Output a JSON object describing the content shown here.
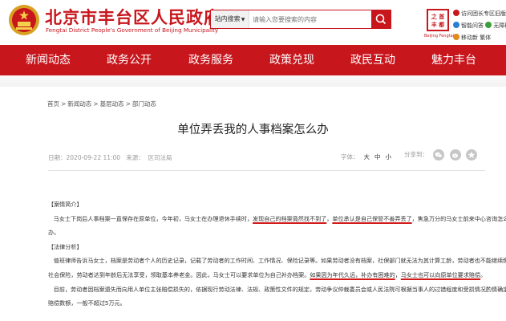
{
  "header": {
    "site_title": "北京市丰台区人民政府",
    "site_subtitle": "Fengtai District People's Government of Beijing Municipality",
    "search": {
      "scope_label": "站内搜索",
      "placeholder": "请输入您要搜索的内容"
    },
    "logo_caption": "Beijing Fengtai",
    "util_links": [
      "访问团长专区旧版",
      "智能问答",
      "无障碍",
      "移动新",
      "繁体"
    ]
  },
  "nav": {
    "items": [
      "新闻动态",
      "政务公开",
      "政务服务",
      "政策兑现",
      "政民互动",
      "魅力丰台"
    ]
  },
  "breadcrumb": {
    "items": [
      "首页",
      "新闻动态",
      "基层动态",
      "部门动态"
    ],
    "separator": ">"
  },
  "article": {
    "title": "单位弄丢我的人事档案怎么办",
    "date_label": "日期：2020-09-22 11:00",
    "source_label": "来源：",
    "source_value": "区司法局",
    "font_size": {
      "label": "字体：",
      "options": [
        "大",
        "中",
        "小"
      ]
    },
    "share_label": "分享到："
  },
  "content": {
    "case_heading": "【案情简介】",
    "p1_a": "马女士下岗后人事档案一直保存在原单位，今年初，马女士在办理退休手续时，",
    "p1_hl1": "发现自己的档案竟然找不到了",
    "p1_b": "，",
    "p1_hl2": "单位承认是自己保管不善弄丢了",
    "p1_c": "，焦急万分的马女士前来中心咨询怎么",
    "p1_d": "办。",
    "legal_heading": "【法律分析】",
    "p2_a": "值班律师告诉马女士，档案是劳动者个人的历史记录，记载了劳动者的工作时间、工作情况、保险记录等。如果劳动者没有档案，社保部门就无法为其计算工龄，劳动者也不能继续缴纳",
    "p2_b": "社会保险，劳动者达到年龄后无法享受，领取基本养老金。因此，马女士可以要求单位为自己补办档案。",
    "p2_hl1": "如果因为年代久远，补办有困难的",
    "p2_c": "，",
    "p2_hl2": "马女士也可以向原单位要求赔偿",
    "p2_d": "。",
    "p3_a": "目前，劳动者因档案遗失而向用人单位主张赔偿损失的，依据现行劳动法律、法规、政策性文件的规定，劳动争议仲裁委员会或人民法院可根据当事人的过错程度和受损情况酌情确定",
    "p3_b": "赔偿数额，一般不超过5万元。"
  },
  "colors": {
    "brand_red": "#c8161d",
    "highlight_underline": "#d21b1b"
  }
}
